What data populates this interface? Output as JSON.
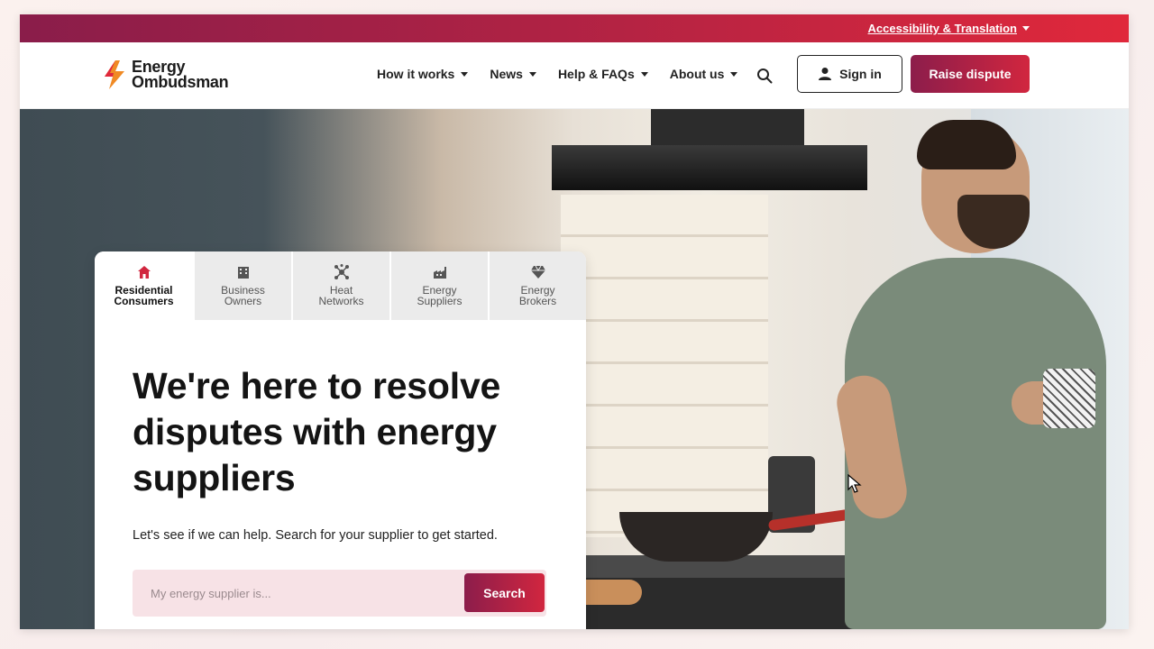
{
  "topbar": {
    "accessibility_link": "Accessibility & Translation"
  },
  "header": {
    "logo_line1": "Energy",
    "logo_line2": "Ombudsman",
    "nav": [
      {
        "label": "How it works"
      },
      {
        "label": "News"
      },
      {
        "label": "Help & FAQs"
      },
      {
        "label": "About us"
      }
    ],
    "sign_in": "Sign in",
    "raise_dispute": "Raise dispute"
  },
  "tabs": [
    {
      "label": "Residential\nConsumers",
      "icon": "home-icon",
      "active": true
    },
    {
      "label": "Business\nOwners",
      "icon": "building-icon",
      "active": false
    },
    {
      "label": "Heat\nNetworks",
      "icon": "network-icon",
      "active": false
    },
    {
      "label": "Energy\nSuppliers",
      "icon": "factory-icon",
      "active": false
    },
    {
      "label": "Energy\nBrokers",
      "icon": "diamond-icon",
      "active": false
    }
  ],
  "hero": {
    "headline": "We're here to resolve disputes with energy suppliers",
    "subtext": "Let's see if we can help. Search for your supplier to get started.",
    "search_placeholder": "My energy supplier is...",
    "search_button": "Search"
  },
  "colors": {
    "brand_dark": "#8c1d4b",
    "brand_red": "#d1263f",
    "search_bg": "#f7e2e6"
  }
}
